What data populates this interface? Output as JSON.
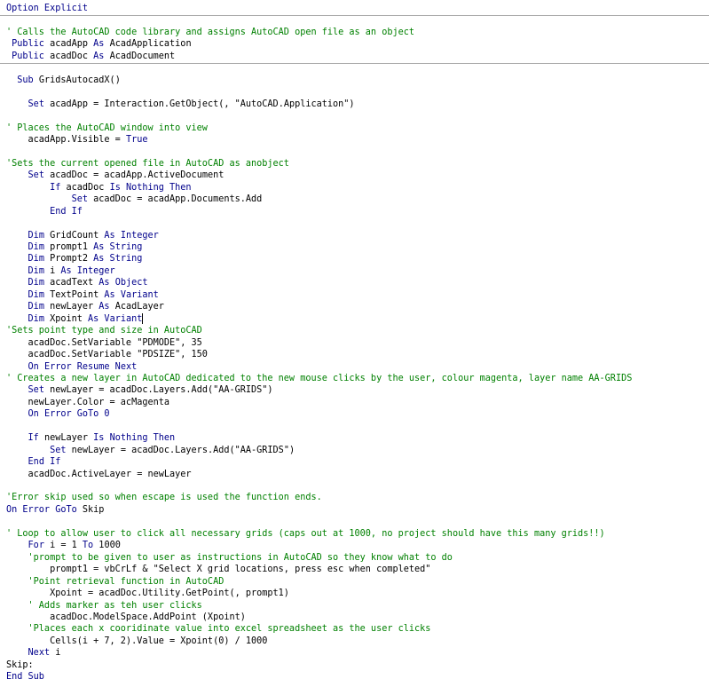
{
  "code_lines": [
    [
      {
        "t": "Option Explicit",
        "c": "kw"
      }
    ],
    [],
    [
      {
        "t": "' Calls the AutoCAD code library and assigns AutoCAD open file as an object",
        "c": "cm"
      }
    ],
    [
      {
        "t": " "
      },
      {
        "t": "Public",
        "c": "kw"
      },
      {
        "t": " acadApp "
      },
      {
        "t": "As",
        "c": "kw"
      },
      {
        "t": " AcadApplication"
      }
    ],
    [
      {
        "t": " "
      },
      {
        "t": "Public",
        "c": "kw"
      },
      {
        "t": " acadDoc "
      },
      {
        "t": "As",
        "c": "kw"
      },
      {
        "t": " AcadDocument"
      }
    ],
    [],
    [
      {
        "t": "  "
      },
      {
        "t": "Sub",
        "c": "kw"
      },
      {
        "t": " GridsAutocadX()"
      }
    ],
    [],
    [
      {
        "t": "    "
      },
      {
        "t": "Set",
        "c": "kw"
      },
      {
        "t": " acadApp = Interaction.GetObject(, \"AutoCAD.Application\")"
      }
    ],
    [],
    [
      {
        "t": "' Places the AutoCAD window into view",
        "c": "cm"
      }
    ],
    [
      {
        "t": "    acadApp.Visible = "
      },
      {
        "t": "True",
        "c": "kw"
      }
    ],
    [],
    [
      {
        "t": "'Sets the current opened file in AutoCAD as anobject",
        "c": "cm"
      }
    ],
    [
      {
        "t": "    "
      },
      {
        "t": "Set",
        "c": "kw"
      },
      {
        "t": " acadDoc = acadApp.ActiveDocument"
      }
    ],
    [
      {
        "t": "        "
      },
      {
        "t": "If",
        "c": "kw"
      },
      {
        "t": " acadDoc "
      },
      {
        "t": "Is Nothing Then",
        "c": "kw"
      }
    ],
    [
      {
        "t": "            "
      },
      {
        "t": "Set",
        "c": "kw"
      },
      {
        "t": " acadDoc = acadApp.Documents.Add"
      }
    ],
    [
      {
        "t": "        "
      },
      {
        "t": "End If",
        "c": "kw"
      }
    ],
    [],
    [
      {
        "t": "    "
      },
      {
        "t": "Dim",
        "c": "kw"
      },
      {
        "t": " GridCount "
      },
      {
        "t": "As Integer",
        "c": "kw"
      }
    ],
    [
      {
        "t": "    "
      },
      {
        "t": "Dim",
        "c": "kw"
      },
      {
        "t": " prompt1 "
      },
      {
        "t": "As String",
        "c": "kw"
      }
    ],
    [
      {
        "t": "    "
      },
      {
        "t": "Dim",
        "c": "kw"
      },
      {
        "t": " Prompt2 "
      },
      {
        "t": "As String",
        "c": "kw"
      }
    ],
    [
      {
        "t": "    "
      },
      {
        "t": "Dim",
        "c": "kw"
      },
      {
        "t": " i "
      },
      {
        "t": "As Integer",
        "c": "kw"
      }
    ],
    [
      {
        "t": "    "
      },
      {
        "t": "Dim",
        "c": "kw"
      },
      {
        "t": " acadText "
      },
      {
        "t": "As Object",
        "c": "kw"
      }
    ],
    [
      {
        "t": "    "
      },
      {
        "t": "Dim",
        "c": "kw"
      },
      {
        "t": " TextPoint "
      },
      {
        "t": "As Variant",
        "c": "kw"
      }
    ],
    [
      {
        "t": "    "
      },
      {
        "t": "Dim",
        "c": "kw"
      },
      {
        "t": " newLayer "
      },
      {
        "t": "As",
        "c": "kw"
      },
      {
        "t": " AcadLayer"
      }
    ],
    [
      {
        "t": "    "
      },
      {
        "t": "Dim",
        "c": "kw"
      },
      {
        "t": " Xpoint "
      },
      {
        "t": "As Variant",
        "c": "kw"
      },
      {
        "t": "",
        "caret": true
      }
    ],
    [
      {
        "t": "'Sets point type and size in AutoCAD",
        "c": "cm"
      }
    ],
    [
      {
        "t": "    acadDoc.SetVariable \"PDMODE\", 35"
      }
    ],
    [
      {
        "t": "    acadDoc.SetVariable \"PDSIZE\", 150"
      }
    ],
    [
      {
        "t": "    "
      },
      {
        "t": "On Error Resume Next",
        "c": "kw"
      }
    ],
    [
      {
        "t": "' Creates a new layer in AutoCAD dedicated to the new mouse clicks by the user, colour magenta, layer name AA-GRIDS",
        "c": "cm"
      }
    ],
    [
      {
        "t": "    "
      },
      {
        "t": "Set",
        "c": "kw"
      },
      {
        "t": " newLayer = acadDoc.Layers.Add(\"AA-GRIDS\")"
      }
    ],
    [
      {
        "t": "    newLayer.Color = acMagenta"
      }
    ],
    [
      {
        "t": "    "
      },
      {
        "t": "On Error GoTo 0",
        "c": "kw"
      }
    ],
    [],
    [
      {
        "t": "    "
      },
      {
        "t": "If",
        "c": "kw"
      },
      {
        "t": " newLayer "
      },
      {
        "t": "Is Nothing Then",
        "c": "kw"
      }
    ],
    [
      {
        "t": "        "
      },
      {
        "t": "Set",
        "c": "kw"
      },
      {
        "t": " newLayer = acadDoc.Layers.Add(\"AA-GRIDS\")"
      }
    ],
    [
      {
        "t": "    "
      },
      {
        "t": "End If",
        "c": "kw"
      }
    ],
    [
      {
        "t": "    acadDoc.ActiveLayer = newLayer"
      }
    ],
    [],
    [
      {
        "t": "'Error skip used so when escape is used the function ends.",
        "c": "cm"
      }
    ],
    [
      {
        "t": "On Error GoTo",
        "c": "kw"
      },
      {
        "t": " Skip"
      }
    ],
    [],
    [
      {
        "t": "' Loop to allow user to click all necessary grids (caps out at 1000, no project should have this many grids!!)",
        "c": "cm"
      }
    ],
    [
      {
        "t": "    "
      },
      {
        "t": "For",
        "c": "kw"
      },
      {
        "t": " i = 1 "
      },
      {
        "t": "To",
        "c": "kw"
      },
      {
        "t": " 1000"
      }
    ],
    [
      {
        "t": "    'prompt to be given to user as instructions in AutoCAD so they know what to do",
        "c": "cm"
      }
    ],
    [
      {
        "t": "        prompt1 = vbCrLf & \"Select X grid locations, press esc when completed\""
      }
    ],
    [
      {
        "t": "    'Point retrieval function in AutoCAD",
        "c": "cm"
      }
    ],
    [
      {
        "t": "        Xpoint = acadDoc.Utility.GetPoint(, prompt1)"
      }
    ],
    [
      {
        "t": "    ' Adds marker as teh user clicks",
        "c": "cm"
      }
    ],
    [
      {
        "t": "        acadDoc.ModelSpace.AddPoint (Xpoint)"
      }
    ],
    [
      {
        "t": "    'Places each x cooridinate value into excel spreadsheet as the user clicks",
        "c": "cm"
      }
    ],
    [
      {
        "t": "        Cells(i + 7, 2).Value = Xpoint(0) / 1000"
      }
    ],
    [
      {
        "t": "    "
      },
      {
        "t": "Next",
        "c": "kw"
      },
      {
        "t": " i"
      }
    ],
    [
      {
        "t": "Skip:"
      }
    ],
    [
      {
        "t": "End Sub",
        "c": "kw"
      }
    ]
  ]
}
